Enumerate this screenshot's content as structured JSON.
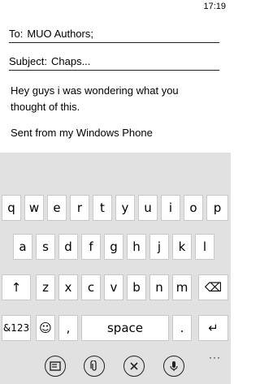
{
  "status": {
    "time": "17:19"
  },
  "compose": {
    "to_label": "To:",
    "to_value": "MUO Authors;",
    "subject_label": "Subject:",
    "subject_value": "Chaps...",
    "body_line1": "Hey guys i was wondering what you",
    "body_line2": "thought of this.",
    "signature": "Sent from my Windows Phone"
  },
  "keyboard": {
    "row1": [
      "q",
      "w",
      "e",
      "r",
      "t",
      "y",
      "u",
      "i",
      "o",
      "p"
    ],
    "row2": [
      "a",
      "s",
      "d",
      "f",
      "g",
      "h",
      "j",
      "k",
      "l"
    ],
    "row3_keys": [
      "z",
      "x",
      "c",
      "v",
      "b",
      "n",
      "m"
    ],
    "shift_icon": "↑",
    "backspace_icon": "⌫",
    "symbols_label": "&123",
    "emoji_icon": "☺",
    "comma": ",",
    "space_label": "space",
    "period": ".",
    "enter_icon": "↵"
  },
  "appbar": {
    "send_icon": "send-icon",
    "attach_icon": "attach-icon",
    "discard_icon": "discard-icon",
    "voice_icon": "microphone-icon",
    "more": "···"
  }
}
